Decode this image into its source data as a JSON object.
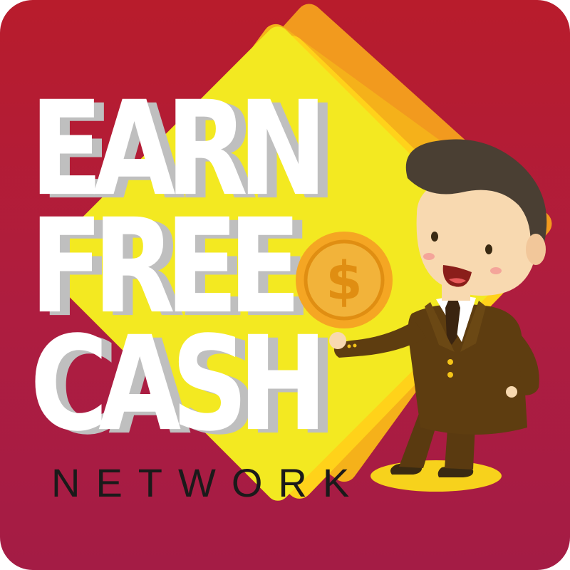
{
  "headline": {
    "line1": "EARN",
    "line2": "FREE",
    "line3": "CASH"
  },
  "subline": "NETWORK",
  "coin_symbol": "$",
  "colors": {
    "background_top": "#b81c2c",
    "background_bottom": "#a41c45",
    "card_yellow": "#f3e921",
    "card_gold": "#f5b11a",
    "card_orange": "#f29a1e",
    "coin": "#f5a623",
    "suit": "#5a3a10",
    "hair": "#4a3f33"
  },
  "icons": [
    "card-stack-illustration",
    "gold-coin-icon",
    "businessman-character"
  ]
}
